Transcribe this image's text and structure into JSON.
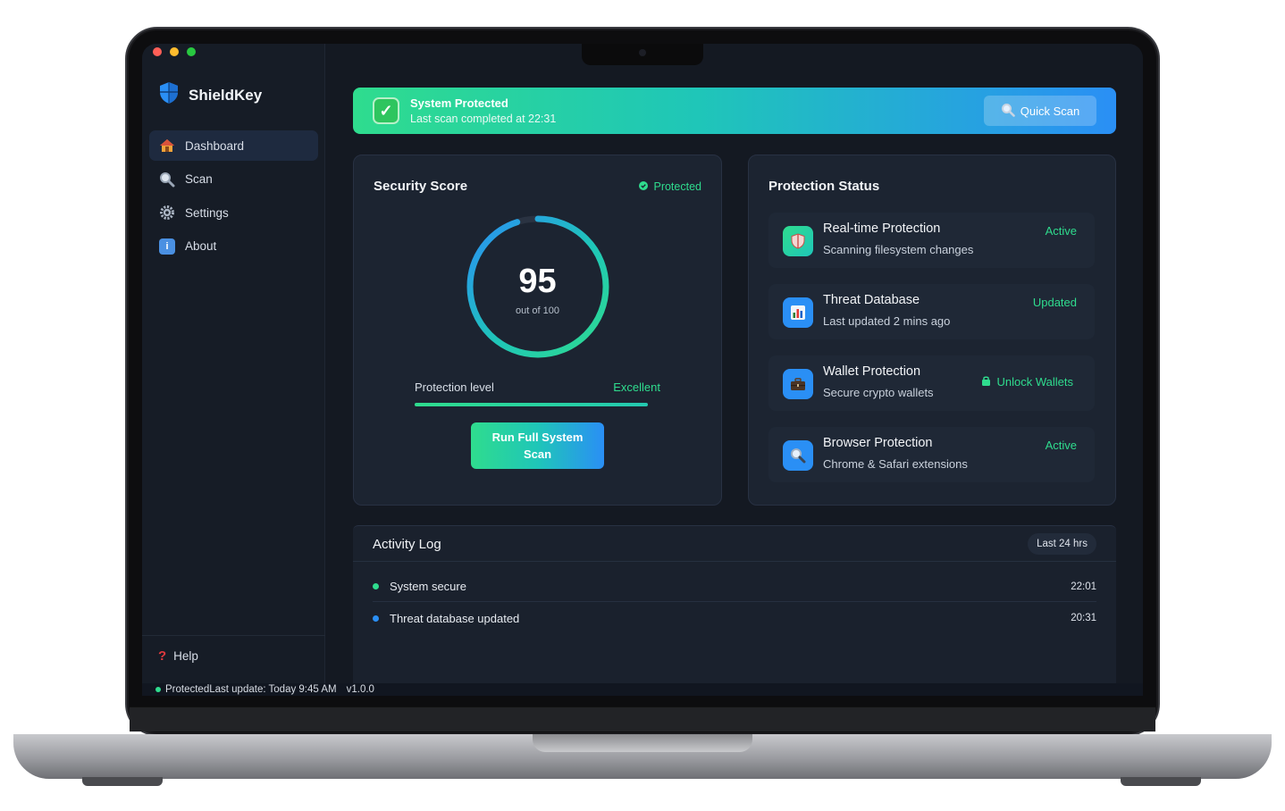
{
  "app": {
    "name": "ShieldKey"
  },
  "sidebar": {
    "items": [
      {
        "label": "Dashboard",
        "icon": "home-icon",
        "active": true
      },
      {
        "label": "Scan",
        "icon": "search-icon",
        "active": false
      },
      {
        "label": "Settings",
        "icon": "gear-icon",
        "active": false
      },
      {
        "label": "About",
        "icon": "info-icon",
        "active": false
      }
    ],
    "help": {
      "label": "Help",
      "icon": "question-icon"
    }
  },
  "status_bar": {
    "state": "Protected",
    "update": "Last update: Today 9:45 AM",
    "version": "v1.0.0"
  },
  "banner": {
    "title": "System Protected",
    "subtitle": "Last scan completed at 22:31",
    "quick_scan": "Quick Scan"
  },
  "security": {
    "title": "Security Score",
    "badge": "Protected",
    "score": "95",
    "score_max": 100,
    "score_sub": "out of 100",
    "level_label": "Protection level",
    "level_value": "Excellent",
    "run_button": "Run Full System Scan"
  },
  "protection": {
    "title": "Protection Status",
    "items": [
      {
        "title": "Real-time Protection",
        "desc": "Scanning filesystem changes",
        "status": "Active",
        "icon": "shield-icon"
      },
      {
        "title": "Threat Database",
        "desc": "Last updated 2 mins ago",
        "status": "Updated",
        "icon": "bar-chart-icon"
      },
      {
        "title": "Wallet Protection",
        "desc": "Secure crypto wallets",
        "action": "Unlock Wallets",
        "icon": "briefcase-icon"
      },
      {
        "title": "Browser Protection",
        "desc": "Chrome & Safari extensions",
        "status": "Active",
        "icon": "magnifier-icon"
      }
    ]
  },
  "activity": {
    "title": "Activity Log",
    "range": "Last 24 hrs",
    "entries": [
      {
        "text": "System secure",
        "time": "22:01",
        "color": "#2fdc8e"
      },
      {
        "text": "Threat database updated",
        "time": "20:31",
        "color": "#2a8ff5"
      }
    ]
  },
  "colors": {
    "accent_green": "#2fdc8e",
    "accent_blue": "#2a8ff5",
    "panel": "#1c2431",
    "background": "#141922"
  }
}
